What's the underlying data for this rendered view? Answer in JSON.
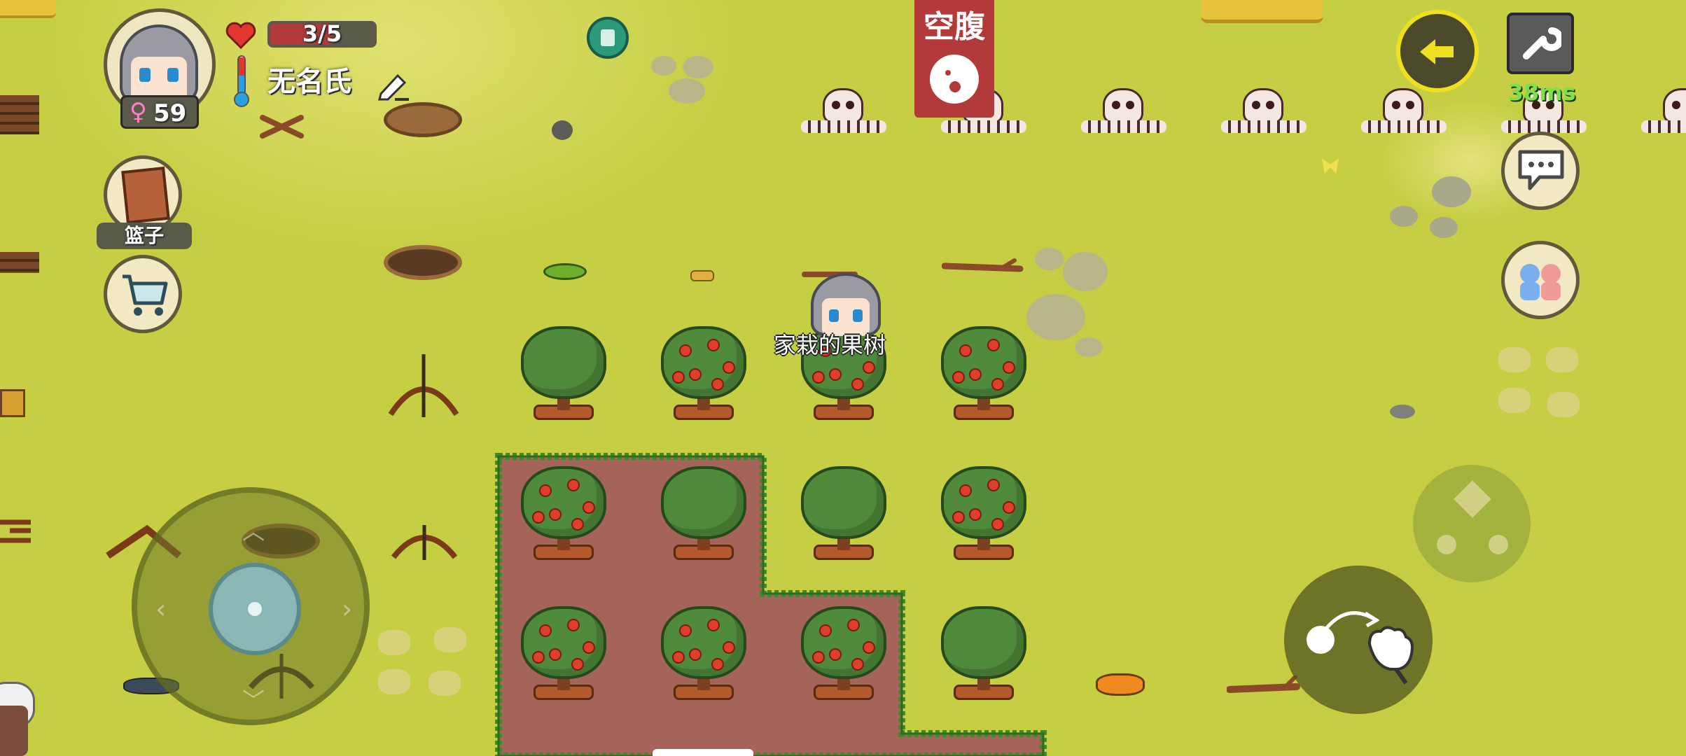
{
  "player": {
    "health_text": "3/5",
    "name": "无名氏",
    "age": "59",
    "nametag": "家栽的果树"
  },
  "status": {
    "hunger_label": "空腹"
  },
  "inventory": {
    "basket_label": "篮子"
  },
  "network": {
    "ping": "38ms"
  },
  "colors": {
    "grass": "#c6cf44",
    "dirt": "#a5645a",
    "hunger_banner": "#b23a3a",
    "ping_text": "#7ee04a",
    "health_bar": "#b23a3a"
  },
  "icons": [
    "heart-icon",
    "thermometer-icon",
    "edit-icon",
    "female-icon",
    "shopping-cart-icon",
    "wrench-icon",
    "return-arrow-icon",
    "chat-icon",
    "friends-icon",
    "grab-hand-icon",
    "joystick-icon",
    "trash-icon"
  ]
}
